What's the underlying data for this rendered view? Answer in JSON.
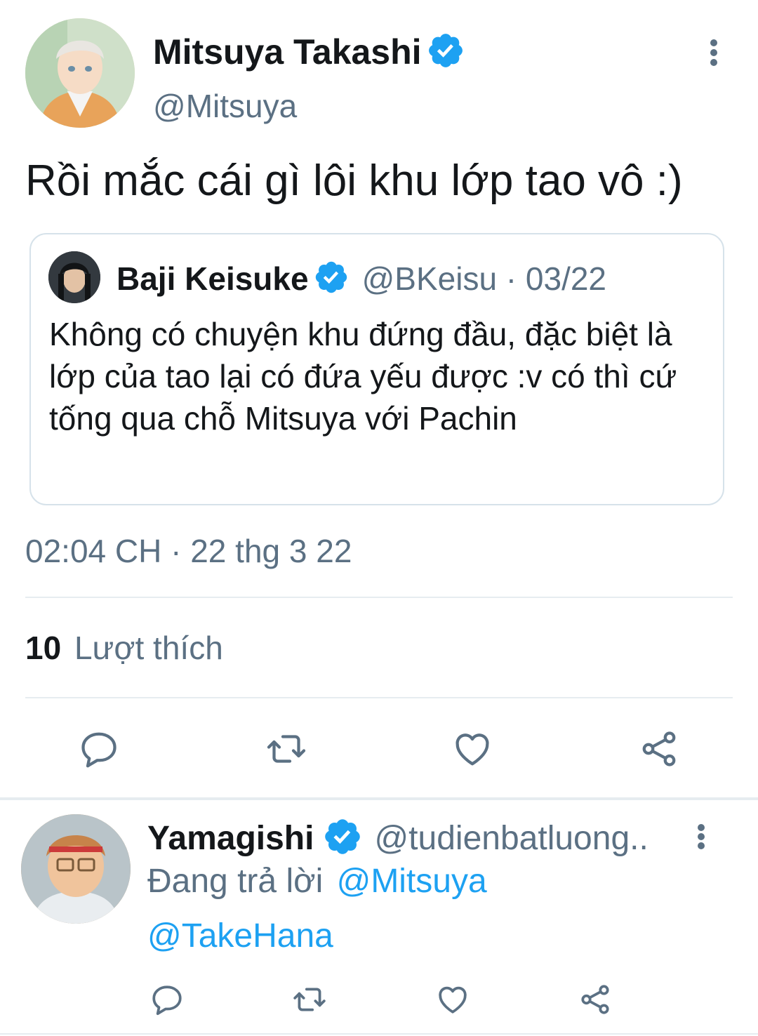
{
  "main_tweet": {
    "author_name": "Mitsuya Takashi",
    "author_handle": "@Mitsuya",
    "text": "Rồi mắc cái gì lôi khu lớp tao vô :)",
    "timestamp": "02:04 CH · 22 thg 3 22",
    "likes_count": "10",
    "likes_label": "Lượt thích"
  },
  "quoted_tweet": {
    "author_name": "Baji Keisuke",
    "handle_date": "@BKeisu · 03/22",
    "text": "Không có chuyện khu đứng đầu, đặc biệt là lớp của tao lại có đứa yếu được :v có thì cứ tống qua chỗ Mitsuya với Pachin"
  },
  "reply_tweet": {
    "author_name": "Yamagishi",
    "author_handle": "@tudienbatluong..",
    "replying_prefix": "Đang trả lời",
    "replying_to": "@Mitsuya",
    "text": "@TakeHana"
  },
  "icons": {
    "verified": "verified-badge-icon",
    "reply": "reply-icon",
    "retweet": "retweet-icon",
    "like": "heart-icon",
    "share": "share-icon",
    "more": "more-options-icon"
  },
  "colors": {
    "accent": "#1da1f2",
    "secondary_text": "#5b7083",
    "divider": "#e6ecf0"
  }
}
